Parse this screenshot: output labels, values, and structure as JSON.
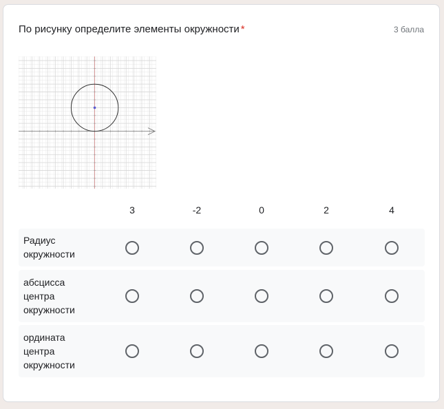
{
  "question": {
    "title": "По рисунку определите элементы окружности",
    "required_mark": "*",
    "points": "3 балла"
  },
  "figure": {
    "description_icon": "circle-on-coordinate-grid",
    "circle": {
      "center_x": 0,
      "center_y": 3,
      "radius": 3
    },
    "x_range": [
      -9,
      8
    ],
    "y_range": [
      -7,
      9
    ]
  },
  "grid": {
    "columns": [
      "3",
      "-2",
      "0",
      "2",
      "4"
    ],
    "rows": [
      {
        "label": "Радиус окружности"
      },
      {
        "label": "абсцисса центра окружности"
      },
      {
        "label": "ордината центра окружности"
      }
    ]
  },
  "colors": {
    "required": "#d93025",
    "radio_border": "#5f6368",
    "row_background": "#f8f9fa"
  }
}
